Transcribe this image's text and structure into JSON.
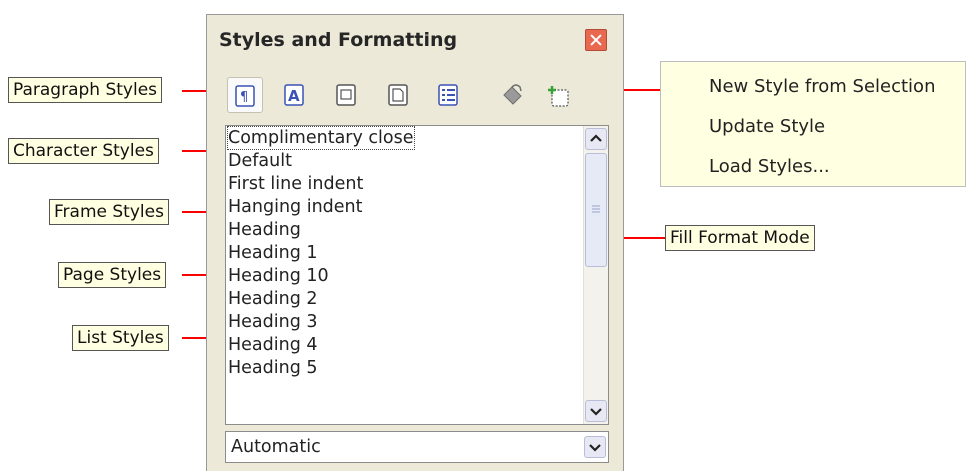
{
  "panel": {
    "title": "Styles and Formatting",
    "toolbar": [
      {
        "name": "paragraph-styles-icon"
      },
      {
        "name": "character-styles-icon"
      },
      {
        "name": "frame-styles-icon"
      },
      {
        "name": "page-styles-icon"
      },
      {
        "name": "list-styles-icon"
      },
      {
        "name": "fill-format-mode-icon"
      },
      {
        "name": "new-style-icon"
      }
    ],
    "styles_list": [
      "Complimentary close",
      "Default",
      "First line indent",
      "Hanging indent",
      "Heading",
      "Heading 1",
      "Heading 10",
      "Heading 2",
      "Heading 3",
      "Heading 4",
      "Heading 5"
    ],
    "filter_value": "Automatic"
  },
  "callouts": {
    "paragraph": "Paragraph Styles",
    "character": "Character Styles",
    "frame": "Frame Styles",
    "page": "Page Styles",
    "list": "List Styles",
    "fill": "Fill Format Mode"
  },
  "menu": {
    "items": [
      "New Style from Selection",
      "Update Style",
      "Load Styles..."
    ]
  },
  "colors": {
    "arrow": "#ff0000",
    "callout_bg": "#ffffe1",
    "panel_bg": "#ece9d8",
    "icon_blue": "#3a52b4"
  }
}
